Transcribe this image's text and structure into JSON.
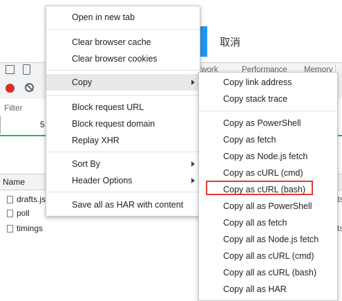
{
  "page": {
    "cancel_label": "取消"
  },
  "devtools": {
    "tabs": [
      "twork",
      "Performance",
      "Memory"
    ],
    "filter_label": "Filter",
    "timeline_value": "5",
    "name_column": "Name",
    "requests": [
      "drafts.js",
      "poll",
      "timings"
    ],
    "right_fragments": [
      "fts",
      "ts"
    ]
  },
  "context_menu": {
    "open_new_tab": "Open in new tab",
    "clear_cache": "Clear browser cache",
    "clear_cookies": "Clear browser cookies",
    "copy": "Copy",
    "block_url": "Block request URL",
    "block_domain": "Block request domain",
    "replay_xhr": "Replay XHR",
    "sort_by": "Sort By",
    "header_options": "Header Options",
    "save_har": "Save all as HAR with content"
  },
  "copy_submenu": {
    "items": [
      "Copy link address",
      "Copy stack trace",
      "Copy as PowerShell",
      "Copy as fetch",
      "Copy as Node.js fetch",
      "Copy as cURL (cmd)",
      "Copy as cURL (bash)",
      "Copy all as PowerShell",
      "Copy all as fetch",
      "Copy all as Node.js fetch",
      "Copy all as cURL (cmd)",
      "Copy all as cURL (bash)",
      "Copy all as HAR"
    ]
  },
  "colors": {
    "highlight_box": "#e53935",
    "record": "#d93025",
    "accent_button": "#2196f3"
  }
}
